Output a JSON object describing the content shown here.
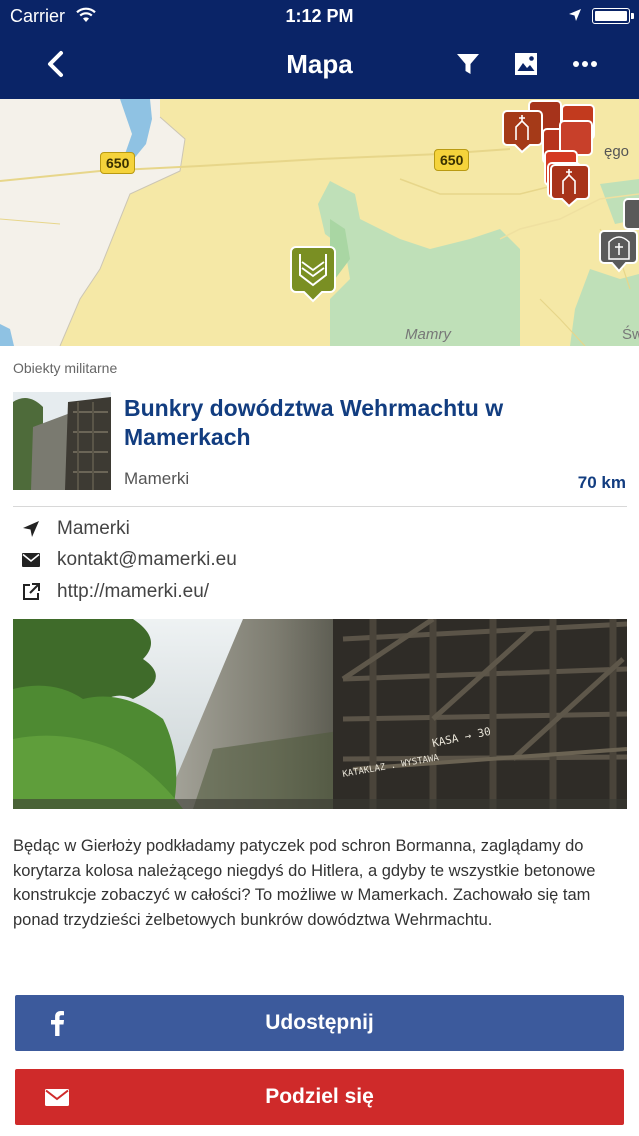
{
  "status_bar": {
    "carrier": "Carrier",
    "time": "1:12 PM"
  },
  "nav": {
    "title": "Mapa",
    "back_icon": "chevron-left-icon",
    "actions": [
      "filter-icon",
      "image-icon",
      "more-icon"
    ]
  },
  "map": {
    "road_number_left": "650",
    "road_number_right": "650",
    "label_mamry": "Mamry",
    "label_right_top": "ęgo",
    "label_right_bottom": "Św"
  },
  "detail": {
    "category": "Obiekty militarne",
    "title": "Bunkry dowództwa Wehrmachtu w Mamerkach",
    "place": "Mamerki",
    "distance": "70 km",
    "address": "Mamerki",
    "email": "kontakt@mamerki.eu",
    "website": "http://mamerki.eu/",
    "description": "Będąc w Gierłoży podkładamy patyczek pod schron Bormanna, zaglądamy do korytarza kolosa należącego niegdyś do Hitlera, a gdyby te wszystkie betonowe konstrukcje zobaczyć w całości? To możliwe w Mamerkach. Zachowało się tam ponad trzydzieści żelbetowych bunkrów dowództwa Wehrmachtu."
  },
  "photo_sign": {
    "line1": "KASA → 30",
    "line2": "KATAKLAZ . WYSTAWA"
  },
  "buttons": {
    "share_label": "Udostępnij",
    "send_label": "Podziel się"
  },
  "colors": {
    "nav_bg": "#0a2467",
    "title_blue": "#123d80",
    "facebook": "#3c5a9c",
    "mail_red": "#cf2a2a"
  }
}
